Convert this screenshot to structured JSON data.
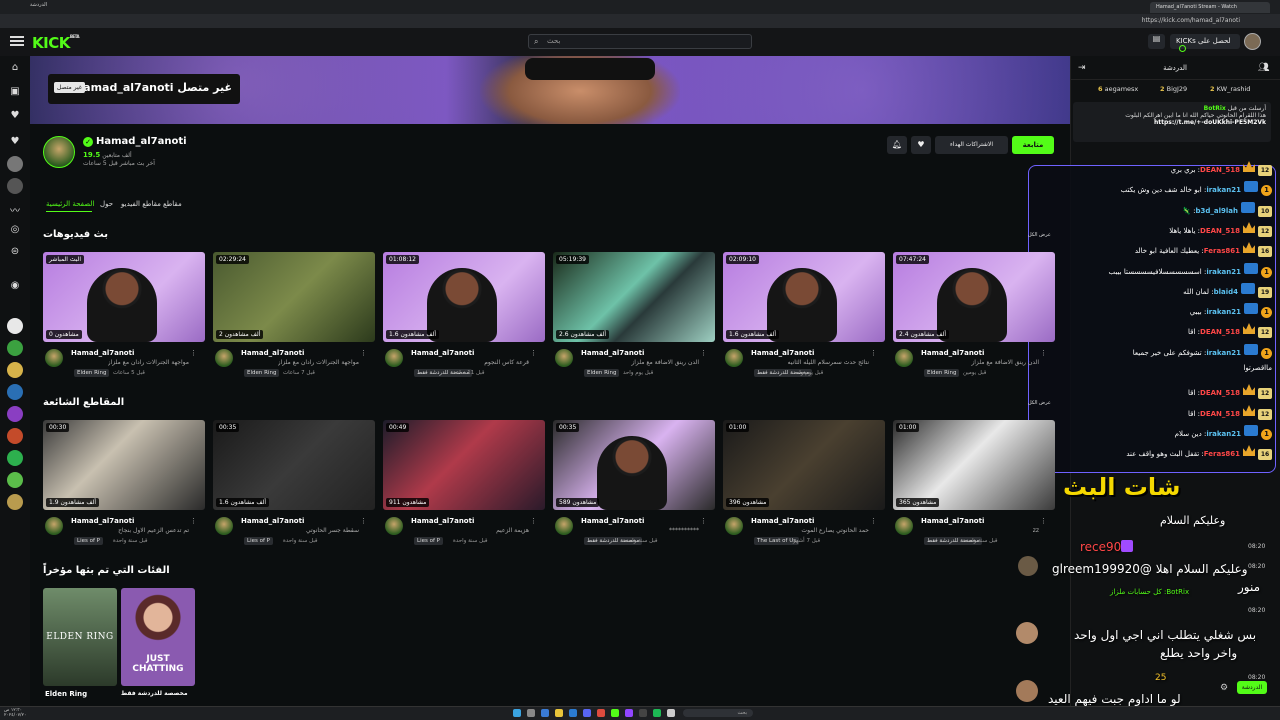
{
  "browser": {
    "tab_title": "Hamad_al7anoti Stream - Watch",
    "left_tab": "الدردشة",
    "url": "https://kick.com/hamad_al7anoti"
  },
  "header": {
    "logo": "KICK",
    "logo_sup": "BETA",
    "search_placeholder": "بحث",
    "login_label": "KICKs لحصل على",
    "accent": "#53fc18"
  },
  "banner": {
    "offline_name": "Hamad_al7anoti غير متصل",
    "offline_badge": "غير متصل"
  },
  "channel": {
    "name": "Hamad_al7anoti",
    "followers_count": "19.5",
    "followers_label": "ألف متابعين",
    "last_live": "آخر بث مباشر قبل 5 ساعات",
    "follow": "متابعة",
    "subs": "الاشتراكات الهداء"
  },
  "tabs": [
    "الصفحة الرئيسية",
    "حول",
    "مقاطع الفيديو",
    "مقاطع"
  ],
  "sections": {
    "videos": "بث فيديوهات",
    "clips": "المقاطع الشائعة",
    "categories": "الفئات التي تم بثها مؤخراً"
  },
  "videos": [
    {
      "dur": "البث المباشر",
      "views": "0 مشاهدون",
      "name": "Hamad_al7anoti",
      "title": "مواجهة الجنرالات رادان مع ملزاز",
      "tag": "Elden Ring",
      "ago": "قبل 5 ساعات"
    },
    {
      "dur": "02:29:24",
      "views": "2 ألف مشاهدون",
      "name": "Hamad_al7anoti",
      "title": "مواجهة الجنرالات رادان مع ملزاز",
      "tag": "Elden Ring",
      "ago": "قبل 7 ساعات"
    },
    {
      "dur": "01:08:12",
      "views": "1.6 ألف مشاهدون",
      "name": "Hamad_al7anoti",
      "title": "قرعة كاس النجوم",
      "tag": "مخصصة للدردشة فقط",
      "ago": "قبل 11 ساعة"
    },
    {
      "dur": "05:19:39",
      "views": "2.6 ألف مشاهدون",
      "name": "Hamad_al7anoti",
      "title": "الدن رينق الاضافة مع ملزاز",
      "tag": "Elden Ring",
      "ago": "قبل يوم واحد"
    },
    {
      "dur": "02:09:10",
      "views": "1.6 ألف مشاهدون",
      "name": "Hamad_al7anoti",
      "title": "نتائج حدث سمرسلام الليله الثانيه",
      "tag": "مخصصة للدردشة فقط",
      "ago": "قبل يوم واحد"
    },
    {
      "dur": "07:47:24",
      "views": "2.4 ألف مشاهدون",
      "name": "Hamad_al7anoti",
      "title": "الدن رينق الاضافة مع ملزاز",
      "tag": "Elden Ring",
      "ago": "قبل يومين"
    }
  ],
  "clips": [
    {
      "dur": "00:30",
      "views": "1.9 ألف مشاهدون",
      "name": "Hamad_al7anoti",
      "title": "تم تدعس الزعيم الاول بنجاح",
      "tag": "Lies of P",
      "ago": "قبل سنة واحدة"
    },
    {
      "dur": "00:35",
      "views": "1.6 ألف مشاهدون",
      "name": "Hamad_al7anoti",
      "title": "سقطة جسر الحانوتي",
      "tag": "Lies of P",
      "ago": "قبل سنة واحدة"
    },
    {
      "dur": "00:49",
      "views": "911 مشاهدون",
      "name": "Hamad_al7anoti",
      "title": "هزيمة الزعيم",
      "tag": "Lies of P",
      "ago": "قبل سنة واحدة"
    },
    {
      "dur": "00:35",
      "views": "589 مشاهدون",
      "name": "Hamad_al7anoti",
      "title": "**********",
      "tag": "مخصصة للدردشة فقط",
      "ago": "قبل سنة واحدة"
    },
    {
      "dur": "01:00",
      "views": "396 مشاهدون",
      "name": "Hamad_al7anoti",
      "title": "حمد الحانوتي يصارع الموت",
      "tag": "The Last of Us",
      "ago": "قبل 7 أشهر"
    },
    {
      "dur": "01:00",
      "views": "365 مشاهدون",
      "name": "Hamad_al7anoti",
      "title": "zz",
      "tag": "مخصصة للدردشة فقط",
      "ago": "قبل سنة واحدة"
    }
  ],
  "categories": [
    {
      "name": "Elden Ring",
      "art_text": "ELDEN RING"
    },
    {
      "name": "مخصصة للدردشة فقط",
      "art_text": "JUST CHATTING"
    }
  ],
  "chat": {
    "title": "الدردشة",
    "top_gifters": [
      {
        "name": "aegamesx",
        "count": "6"
      },
      {
        "name": "BigJ29",
        "count": "2"
      },
      {
        "name": "KW_rashid",
        "count": "2"
      }
    ],
    "pinned_sender": "BotRix",
    "pinned_meta": "أرسلت من قبل",
    "pinned_text": "هذا اللقرام الحانوتي حياكم الله انا ما ابين اهرالكم البلوت",
    "pinned_link": "https://t.me/+-doUKkhi-PE5M2Vk",
    "send_label": "الدردشة"
  },
  "overlay_messages": [
    {
      "lvl": "12",
      "user": "DEAN_518",
      "color": "red",
      "text": "بري بري"
    },
    {
      "lvl": "1",
      "user": "irakan21",
      "color": "blue",
      "text": "ابو خالد شف دين وش يكتب"
    },
    {
      "lvl": "10",
      "user": "b3d_al9lah",
      "color": "blue",
      "text": "🦎"
    },
    {
      "lvl": "12",
      "user": "DEAN_518",
      "color": "red",
      "text": "ياهلا ياهلا"
    },
    {
      "lvl": "16",
      "user": "Feras861",
      "color": "red",
      "text": "يعطيك العافية ابو خالد"
    },
    {
      "lvl": "1",
      "user": "irakan21",
      "color": "blue",
      "text": "اسسسسسسلافيسسسستا بيبب"
    },
    {
      "lvl": "19",
      "user": "blaid4",
      "color": "blue",
      "text": "لمان الله"
    },
    {
      "lvl": "1",
      "user": "irakan21",
      "color": "blue",
      "text": "بيبي"
    },
    {
      "lvl": "12",
      "user": "DEAN_518",
      "color": "red",
      "text": "اقا"
    },
    {
      "lvl": "1",
      "user": "irakan21",
      "color": "blue",
      "text": "تشوفكم على خير جميعا"
    },
    {
      "lvl": "",
      "user": "",
      "color": "white",
      "text": "مااقصرتوا"
    },
    {
      "lvl": "12",
      "user": "DEAN_518",
      "color": "red",
      "text": "اقا"
    },
    {
      "lvl": "12",
      "user": "DEAN_518",
      "color": "red",
      "text": "اقا"
    },
    {
      "lvl": "1",
      "user": "irakan21",
      "color": "blue",
      "text": "دين سلام"
    },
    {
      "lvl": "16",
      "user": "Feras861",
      "color": "red",
      "text": "تقفل البث وهو واقف عند"
    }
  ],
  "overlay_side_labels": [
    "عرض الكل",
    "عرض الكل"
  ],
  "stream_chat": {
    "logo": "شات البث",
    "lines": [
      {
        "text": "وعليكم السلام",
        "time": "08:20"
      },
      {
        "text": "rece90",
        "time": "08:20"
      },
      {
        "text": "وعليكم السلام اهلا @glreem199920",
        "time": ""
      },
      {
        "text": "منور",
        "time": ""
      },
      {
        "text": "BotRix: كل حسابات ملزاز",
        "time": "08:20"
      },
      {
        "text": "بس شغلي يتطلب اني اجي اول واحد",
        "time": ""
      },
      {
        "text": "واخر واحد يطلع",
        "time": ""
      },
      {
        "text": "25",
        "time": "08:20"
      },
      {
        "text": "لو ما اداوم جبت فيهم العيد",
        "time": ""
      }
    ]
  },
  "taskbar": {
    "search": "بحث",
    "clock_time": "١٢:٣٠ ص",
    "clock_date": "٢٠٢٤/٠٧/٢٠"
  }
}
